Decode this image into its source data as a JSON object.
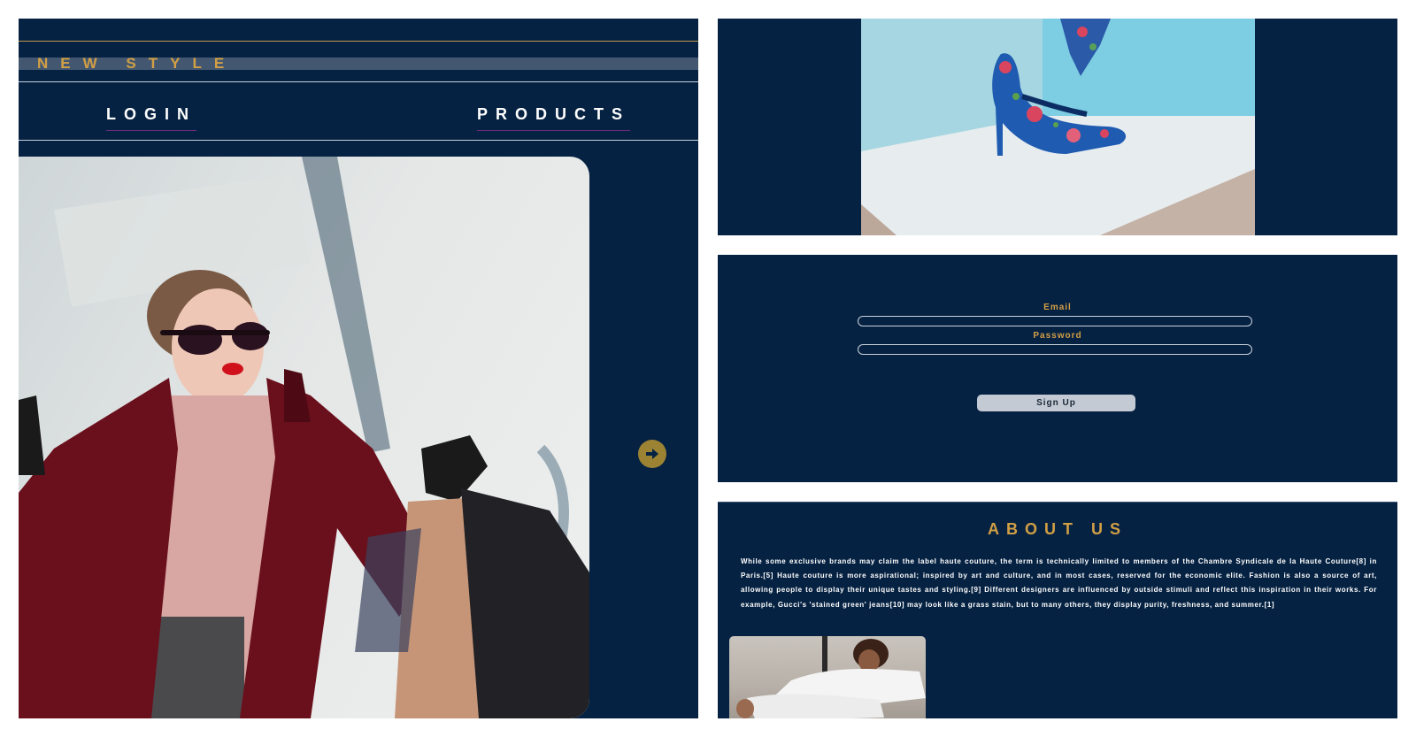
{
  "header": {
    "brand": "NEW STYLE",
    "nav": {
      "login_label": "LOGIN",
      "products_label": "PRODUCTS"
    }
  },
  "icons": {
    "next": "arrow-right-circle-icon"
  },
  "colors": {
    "panel_bg": "#062242",
    "accent_gold": "#d29f45",
    "nav_text": "#ffffff",
    "button_bg": "#c4cad3"
  },
  "signup": {
    "email_label": "Email",
    "email_value": "",
    "password_label": "Password",
    "password_value": "",
    "submit_label": "Sign Up"
  },
  "about": {
    "title": "ABOUT US",
    "body": "While some exclusive brands may claim the label haute couture, the term is technically limited to members of the Chambre Syndicale de la Haute Couture[8] in Paris.[5] Haute couture is more aspirational; inspired by art and culture, and in most cases, reserved for the economic elite. Fashion is also a source of art, allowing people to display their unique tastes and styling.[9] Different designers are influenced by outside stimuli and reflect this inspiration in their works. For example, Gucci's 'stained green' jeans[10] may look like a grass stain, but to many others, they display purity, freshness, and summer.[1]"
  }
}
